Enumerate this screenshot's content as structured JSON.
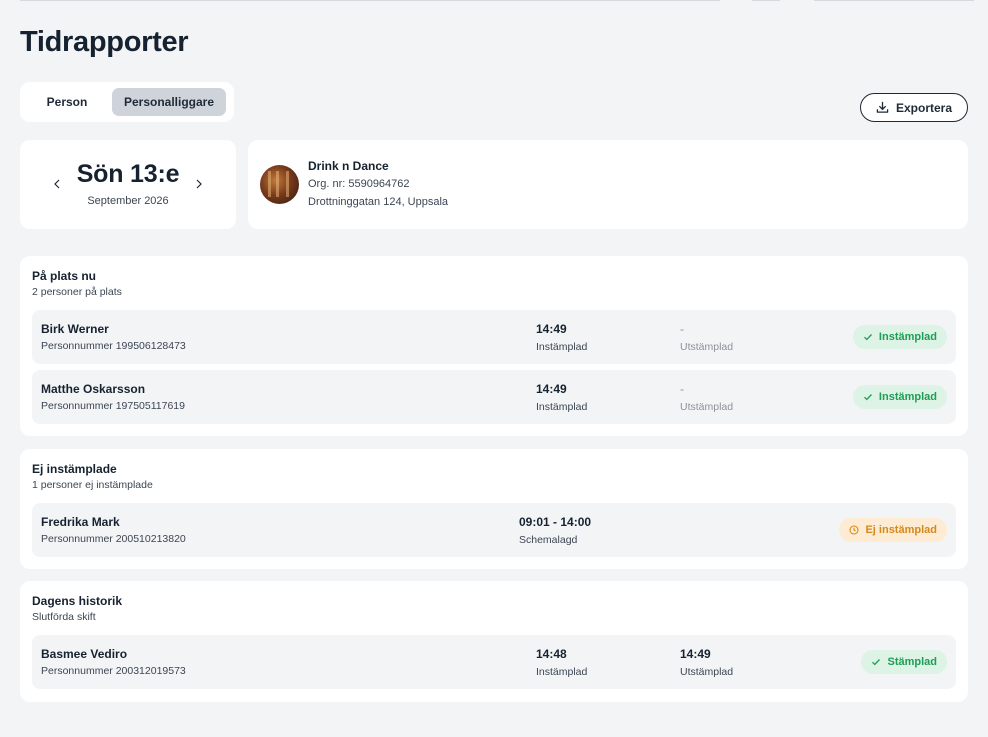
{
  "page": {
    "title": "Tidrapporter"
  },
  "tabs": [
    {
      "label": "Person",
      "active": false
    },
    {
      "label": "Personalliggare",
      "active": true
    }
  ],
  "export": {
    "label": "Exportera",
    "icon": "download-icon"
  },
  "date": {
    "main": "Sön 13:e",
    "sub": "September 2026"
  },
  "company": {
    "name": "Drink n Dance",
    "org": "Org. nr: 5590964762",
    "address": "Drottninggatan 124, Uppsala"
  },
  "sections": {
    "on_site": {
      "title": "På plats nu",
      "subtitle": "2 personer på plats",
      "rows": [
        {
          "name": "Birk Werner",
          "pnr": "Personnummer 199506128473",
          "in_time": "14:49",
          "in_label": "Instämplad",
          "out_time": "-",
          "out_label": "Utstämplad",
          "badge": "Instämplad"
        },
        {
          "name": "Matthe Oskarsson",
          "pnr": "Personnummer 197505117619",
          "in_time": "14:49",
          "in_label": "Instämplad",
          "out_time": "-",
          "out_label": "Utstämplad",
          "badge": "Instämplad"
        }
      ]
    },
    "not_clocked": {
      "title": "Ej instämplade",
      "subtitle": "1 personer ej instämplade",
      "rows": [
        {
          "name": "Fredrika Mark",
          "pnr": "Personnummer 200510213820",
          "schedule": "09:01 - 14:00",
          "schedule_label": "Schemalagd",
          "badge": "Ej instämplad"
        }
      ]
    },
    "history": {
      "title": "Dagens historik",
      "subtitle": "Slutförda skift",
      "rows": [
        {
          "name": "Basmee Vediro",
          "pnr": "Personnummer 200312019573",
          "in_time": "14:48",
          "in_label": "Instämplad",
          "out_time": "14:49",
          "out_label": "Utstämplad",
          "badge": "Stämplad"
        }
      ]
    }
  },
  "colors": {
    "success": "#1f9d55",
    "success_bg": "#dcf3e6",
    "warning": "#d48a1a",
    "warning_bg": "#fdebd3"
  }
}
